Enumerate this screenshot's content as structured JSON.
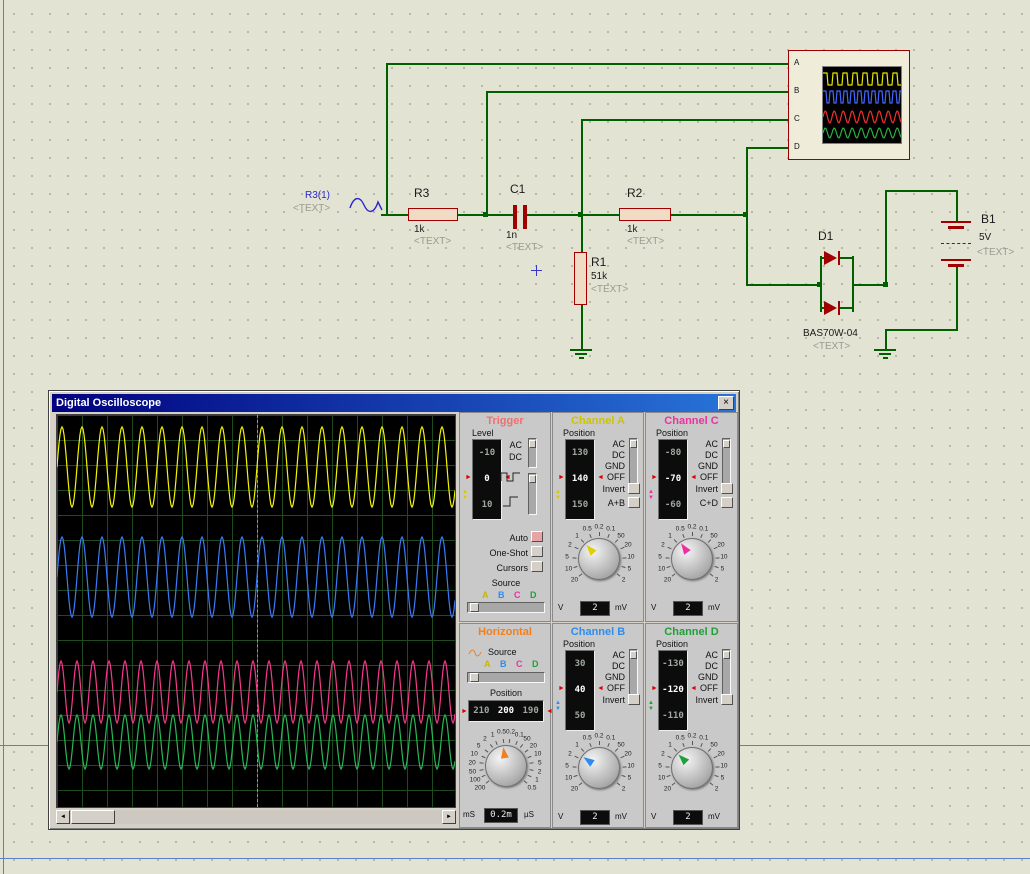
{
  "icons": {
    "close": "×",
    "scroll_left": "◄",
    "scroll_right": "►",
    "marker_left": "◄",
    "marker_right": "►",
    "nudge_up": "▲",
    "nudge_down": "▼"
  },
  "window": {
    "title": "Digital Oscilloscope"
  },
  "display": {
    "waves": [
      {
        "channel": "A",
        "type": "sine",
        "color": "#F5F500",
        "center": 52,
        "amp": 40,
        "period": 20
      },
      {
        "channel": "B",
        "type": "sine",
        "color": "#3A7CF5",
        "center": 162,
        "amp": 40,
        "period": 20
      },
      {
        "channel": "C",
        "type": "sine",
        "color": "#F53A8C",
        "center": 277,
        "amp": 31,
        "period": 16
      },
      {
        "channel": "D",
        "type": "sine",
        "color": "#28B858",
        "center": 327,
        "amp": 27,
        "period": 16
      }
    ]
  },
  "trigger": {
    "title": "Trigger",
    "level_label": "Level",
    "levels": [
      "-10",
      "0",
      "10"
    ],
    "ac": "AC",
    "dc": "DC",
    "auto": "Auto",
    "one_shot": "One-Shot",
    "cursors": "Cursors",
    "source_label": "Source",
    "sources": [
      "A",
      "B",
      "C",
      "D"
    ]
  },
  "horizontal": {
    "title": "Horizontal",
    "source_label": "Source",
    "sources": [
      "A",
      "B",
      "C",
      "D"
    ],
    "position_label": "Position",
    "positions": [
      "210",
      "200",
      "190"
    ],
    "unit_left": "mS",
    "unit_right": "µS",
    "value": "0.2m",
    "knob": {
      "left": [
        "200",
        "100",
        "50",
        "20",
        "10",
        "5",
        "2",
        "1"
      ],
      "top": [
        "0.5",
        "0.2",
        "0.1"
      ],
      "right": [
        "50",
        "20",
        "10",
        "5",
        "2",
        "1",
        "0.5"
      ],
      "color": "#F08020",
      "angle": -8,
      "r": 34
    }
  },
  "channel_a": {
    "title": "Channel A",
    "position_label": "Position",
    "positions": [
      "130",
      "140",
      "150"
    ],
    "coupling": [
      "AC",
      "DC",
      "GND",
      "OFF"
    ],
    "invert": "Invert",
    "sum": "A+B",
    "unit_left": "V",
    "unit_right": "mV",
    "value": "2",
    "knob": {
      "left": [
        "20",
        "10",
        "5",
        "2",
        "1"
      ],
      "top": [
        "0.5",
        "0.2",
        "0.1"
      ],
      "right": [
        "50",
        "20",
        "10",
        "5",
        "2"
      ],
      "color": "#E0D000",
      "angle": -42
    }
  },
  "channel_b": {
    "title": "Channel B",
    "position_label": "Position",
    "positions": [
      "30",
      "40",
      "50"
    ],
    "coupling": [
      "AC",
      "DC",
      "GND",
      "OFF"
    ],
    "invert": "Invert",
    "unit_left": "V",
    "unit_right": "mV",
    "value": "2",
    "knob": {
      "left": [
        "20",
        "10",
        "5",
        "2",
        "1"
      ],
      "top": [
        "0.5",
        "0.2",
        "0.1"
      ],
      "right": [
        "50",
        "20",
        "10",
        "5",
        "2"
      ],
      "color": "#2E8CF0",
      "angle": -55
    }
  },
  "channel_c": {
    "title": "Channel C",
    "position_label": "Position",
    "positions": [
      "-80",
      "-70",
      "-60"
    ],
    "coupling": [
      "AC",
      "DC",
      "GND",
      "OFF"
    ],
    "invert": "Invert",
    "sum": "C+D",
    "unit_left": "V",
    "unit_right": "mV",
    "value": "2",
    "knob": {
      "left": [
        "20",
        "10",
        "5",
        "2",
        "1"
      ],
      "top": [
        "0.5",
        "0.2",
        "0.1"
      ],
      "right": [
        "50",
        "20",
        "10",
        "5",
        "2"
      ],
      "color": "#EE30A0",
      "angle": -35
    }
  },
  "channel_d": {
    "title": "Channel D",
    "position_label": "Position",
    "positions": [
      "-130",
      "-120",
      "-110"
    ],
    "coupling": [
      "AC",
      "DC",
      "GND",
      "OFF"
    ],
    "invert": "Invert",
    "unit_left": "V",
    "unit_right": "mV",
    "value": "2",
    "knob": {
      "left": [
        "20",
        "10",
        "5",
        "2",
        "1"
      ],
      "top": [
        "0.5",
        "0.2",
        "0.1"
      ],
      "right": [
        "50",
        "20",
        "10",
        "5",
        "2"
      ],
      "color": "#1FA038",
      "angle": -45
    }
  },
  "schematic": {
    "generator": {
      "label": "R3(1)",
      "text": "<TEXT>"
    },
    "r3": {
      "ref": "R3",
      "value": "1k",
      "text": "<TEXT>"
    },
    "c1": {
      "ref": "C1",
      "value": "1n",
      "text": "<TEXT>"
    },
    "r2": {
      "ref": "R2",
      "value": "1k",
      "text": "<TEXT>"
    },
    "r1": {
      "ref": "R1",
      "value": "51k",
      "text": "<TEXT>"
    },
    "d1": {
      "ref": "D1",
      "value": "BAS70W-04",
      "text": "<TEXT>"
    },
    "b1": {
      "ref": "B1",
      "value": "5V",
      "text": "<TEXT>"
    },
    "pins": [
      "A",
      "B",
      "C",
      "D"
    ],
    "preview": {
      "waves": [
        {
          "channel": "A",
          "type": "square",
          "color": "#E8E800",
          "center": 12,
          "amp": 6,
          "period": 10
        },
        {
          "channel": "B",
          "type": "square",
          "color": "#4468FF",
          "center": 30,
          "amp": 6,
          "period": 7
        },
        {
          "channel": "C",
          "type": "sine",
          "color": "#F03030",
          "center": 50,
          "amp": 6,
          "period": 9
        },
        {
          "channel": "D",
          "type": "sine",
          "color": "#28B040",
          "center": 66,
          "amp": 5,
          "period": 9
        }
      ]
    }
  }
}
